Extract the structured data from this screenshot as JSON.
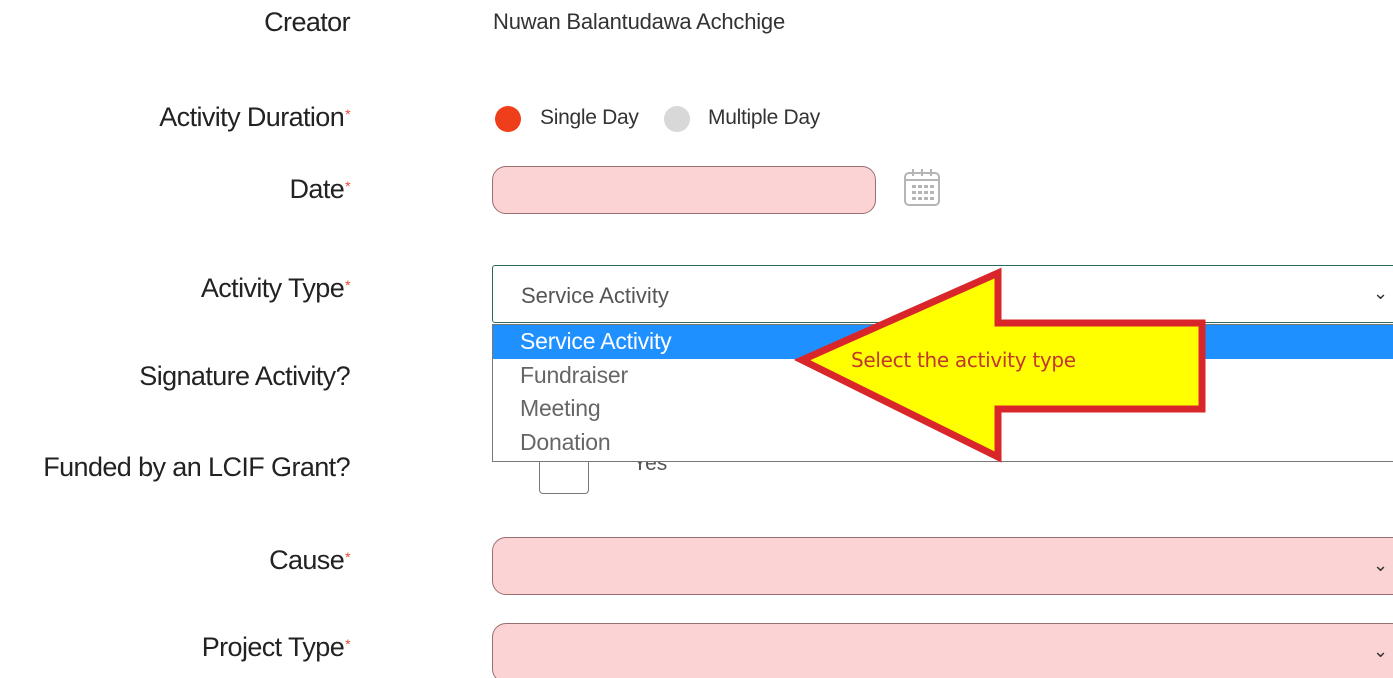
{
  "form": {
    "creator": {
      "label": "Creator",
      "value": "Nuwan Balantudawa Achchige"
    },
    "activity_duration": {
      "label": "Activity Duration",
      "required_mark": "*",
      "options": [
        {
          "label": "Single Day",
          "selected": true
        },
        {
          "label": "Multiple Day",
          "selected": false
        }
      ]
    },
    "date": {
      "label": "Date",
      "required_mark": "*",
      "value": "",
      "calendar_icon": "calendar-icon"
    },
    "activity_type": {
      "label": "Activity Type",
      "required_mark": "*",
      "selected": "Service Activity",
      "options": [
        "Service Activity",
        "Fundraiser",
        "Meeting",
        "Donation"
      ],
      "highlighted_index": 0
    },
    "signature_activity": {
      "label": "Signature Activity?"
    },
    "lcif_grant": {
      "label": "Funded by an LCIF Grant?",
      "checkbox_label": "Yes"
    },
    "cause": {
      "label": "Cause",
      "required_mark": "*",
      "value": ""
    },
    "project_type": {
      "label": "Project Type",
      "required_mark": "*",
      "value": ""
    }
  },
  "annotation": {
    "text": "Select the activity type",
    "arrow_fill": "#ffff00",
    "arrow_stroke": "#d9262b"
  },
  "colors": {
    "accent_radio": "#ef3e1a",
    "error_field_bg": "#fcd3d5",
    "dropdown_highlight": "#1e90ff",
    "select_border": "#2e6a5a"
  }
}
